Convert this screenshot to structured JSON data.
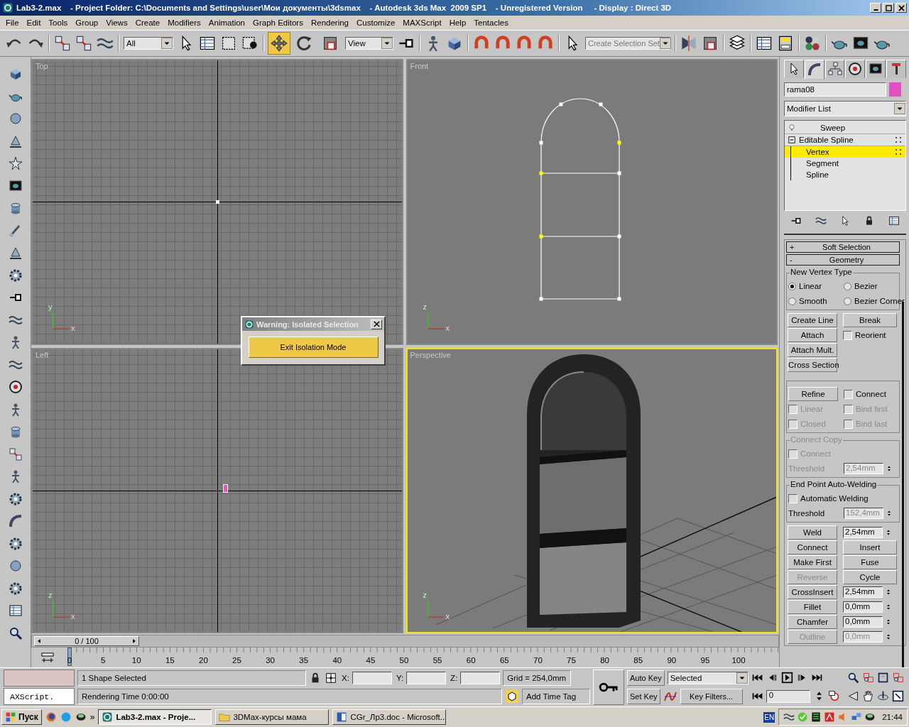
{
  "window": {
    "title": "Lab3-2.max    - Project Folder: C:\\Documents and Settings\\user\\Мои документы\\3dsmax    - Autodesk 3ds Max  2009 SP1    - Unregistered Version     - Display : Direct 3D"
  },
  "menu": [
    "File",
    "Edit",
    "Tools",
    "Group",
    "Views",
    "Create",
    "Modifiers",
    "Animation",
    "Graph Editors",
    "Rendering",
    "Customize",
    "MAXScript",
    "Help",
    "Tentacles"
  ],
  "toolbar": {
    "filter": "All",
    "coord_system": "View",
    "selection_set_placeholder": "Create Selection Set",
    "transform_tools": [
      {
        "kind": "move",
        "selected": true
      },
      {
        "kind": "rotate",
        "selected": false
      },
      {
        "kind": "scale",
        "selected": false
      }
    ]
  },
  "viewports": [
    {
      "label": "Top",
      "kind": "top",
      "active": false,
      "axis_up": "y",
      "axis_right": "x"
    },
    {
      "label": "Front",
      "kind": "front",
      "active": false,
      "axis_up": "z",
      "axis_right": "x"
    },
    {
      "label": "Left",
      "kind": "left",
      "active": false,
      "axis_up": "z",
      "axis_right": "x"
    },
    {
      "label": "Perspective",
      "kind": "perspective",
      "active": true,
      "axis_up": "z",
      "axis_right": "x"
    }
  ],
  "isolation_dialog": {
    "title": "Warning: Isolated Selection",
    "button": "Exit Isolation Mode"
  },
  "command_panel": {
    "tabs": [
      {
        "kind": "create",
        "selected": false
      },
      {
        "kind": "modify",
        "selected": true
      },
      {
        "kind": "hierarchy",
        "selected": false
      },
      {
        "kind": "motion",
        "selected": false
      },
      {
        "kind": "display",
        "selected": false
      },
      {
        "kind": "utilities",
        "selected": false
      }
    ],
    "object": {
      "name": "rama08",
      "color": "#e050c0"
    },
    "modifier_list": "Modifier List",
    "stack": [
      {
        "label": "Sweep",
        "selected": false
      },
      {
        "label": "Editable Spline",
        "selected": false,
        "expanded": true,
        "children": [
          {
            "label": "Vertex",
            "selected": true
          },
          {
            "label": "Segment",
            "selected": false
          },
          {
            "label": "Spline",
            "selected": false
          }
        ]
      }
    ],
    "rollouts": [
      {
        "sign": "+",
        "label": "Soft Selection"
      },
      {
        "sign": "-",
        "label": "Geometry"
      }
    ],
    "sections": [
      {
        "framed": true,
        "title": "New Vertex Type",
        "disabled": false,
        "rows": [
          [
            {
              "kind": "radio",
              "label": "Linear",
              "selected": true,
              "disabled": false
            },
            {
              "kind": "radio",
              "label": "Bezier",
              "selected": false,
              "disabled": false
            }
          ],
          [
            {
              "kind": "radio",
              "label": "Smooth",
              "selected": false,
              "disabled": false
            },
            {
              "kind": "radio",
              "label": "Bezier Corner",
              "selected": false,
              "disabled": false
            }
          ]
        ]
      },
      {
        "framed": false,
        "rows": [
          [
            {
              "kind": "button",
              "label": "Create Line",
              "disabled": false
            },
            {
              "kind": "button",
              "label": "Break",
              "disabled": false
            }
          ],
          [
            {
              "kind": "button",
              "label": "Attach",
              "disabled": false
            },
            {
              "kind": "checkbox",
              "label": "Reorient",
              "checked": false,
              "disabled": false
            }
          ],
          [
            {
              "kind": "button",
              "label": "Attach Mult.",
              "disabled": false
            }
          ],
          [
            {
              "kind": "button",
              "label": "Cross Section",
              "disabled": false
            }
          ]
        ]
      },
      {
        "framed": true,
        "rows": [
          [
            {
              "kind": "button",
              "label": "Refine",
              "disabled": false
            },
            {
              "kind": "checkbox",
              "label": "Connect",
              "checked": false,
              "disabled": false
            }
          ],
          [
            {
              "kind": "checkbox",
              "label": "Linear",
              "checked": false,
              "disabled": true
            },
            {
              "kind": "checkbox",
              "label": "Bind first",
              "checked": false,
              "disabled": true
            }
          ],
          [
            {
              "kind": "checkbox",
              "label": "Closed",
              "checked": false,
              "disabled": true
            },
            {
              "kind": "checkbox",
              "label": "Bind last",
              "checked": false,
              "disabled": true
            }
          ]
        ]
      },
      {
        "framed": true,
        "title": "Connect Copy",
        "disabled": true,
        "rows": [
          [
            {
              "kind": "checkbox",
              "label": "Connect",
              "checked": false,
              "disabled": true
            }
          ],
          [
            {
              "kind": "label",
              "label": "Threshold",
              "disabled": true
            },
            {
              "kind": "spinner",
              "value": "2,54mm",
              "disabled": true
            }
          ]
        ]
      },
      {
        "framed": true,
        "title": "End Point Auto-Welding",
        "disabled": false,
        "rows": [
          [
            {
              "kind": "checkbox",
              "label": "Automatic Welding",
              "checked": false,
              "disabled": false
            }
          ],
          [
            {
              "kind": "label",
              "label": "Threshold",
              "disabled": false
            },
            {
              "kind": "spinner",
              "value": "152,4mm",
              "disabled": true
            }
          ]
        ]
      },
      {
        "framed": false,
        "rows": [
          [
            {
              "kind": "button",
              "label": "Weld",
              "disabled": false
            },
            {
              "kind": "spinner",
              "value": "2,54mm",
              "disabled": false
            }
          ],
          [
            {
              "kind": "button",
              "label": "Connect",
              "disabled": false
            },
            {
              "kind": "button",
              "label": "Insert",
              "disabled": false
            }
          ],
          [
            {
              "kind": "button",
              "label": "Make First",
              "disabled": false
            },
            {
              "kind": "button",
              "label": "Fuse",
              "disabled": false
            }
          ],
          [
            {
              "kind": "button",
              "label": "Reverse",
              "disabled": true
            },
            {
              "kind": "button",
              "label": "Cycle",
              "disabled": false
            }
          ],
          [
            {
              "kind": "button",
              "label": "CrossInsert",
              "disabled": false
            },
            {
              "kind": "spinner",
              "value": "2,54mm",
              "disabled": false
            }
          ],
          [
            {
              "kind": "button",
              "label": "Fillet",
              "disabled": false
            },
            {
              "kind": "spinner",
              "value": "0,0mm",
              "disabled": false
            }
          ],
          [
            {
              "kind": "button",
              "label": "Chamfer",
              "disabled": false
            },
            {
              "kind": "spinner",
              "value": "0,0mm",
              "disabled": false
            }
          ],
          [
            {
              "kind": "button",
              "label": "Outline",
              "disabled": true
            },
            {
              "kind": "spinner",
              "value": "0,0mm",
              "disabled": true
            }
          ]
        ]
      }
    ]
  },
  "time_slider": {
    "position": "0 / 100"
  },
  "track_bar": {
    "ticks": [
      "0",
      "5",
      "10",
      "15",
      "20",
      "25",
      "30",
      "35",
      "40",
      "45",
      "50",
      "55",
      "60",
      "65",
      "70",
      "75",
      "80",
      "85",
      "90",
      "95",
      "100"
    ]
  },
  "status": {
    "listener": "AXScript.",
    "selection_info": "1 Shape Selected",
    "prompt": "Rendering Time  0:00:00",
    "coords": [
      "X:",
      "Y:",
      "Z:"
    ],
    "grid": "Grid = 254,0mm",
    "time_tag": "Add Time Tag",
    "auto_key": "Auto Key",
    "set_key": "Set Key",
    "key_set": "Selected",
    "key_filters": "Key Filters...",
    "frame": "0"
  },
  "taskbar": {
    "start": "Пуск",
    "more": "»",
    "tasks": [
      {
        "label": "Lab3-2.max     - Proje...",
        "kind": "max",
        "selected": true
      },
      {
        "label": "3DMax-курсы мама",
        "kind": "folder",
        "selected": false
      },
      {
        "label": "CGr_Лр3.doc - Microsoft...",
        "kind": "word",
        "selected": false
      }
    ],
    "language": "EN",
    "clock": "21:44"
  }
}
